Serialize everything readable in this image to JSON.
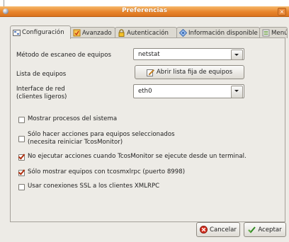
{
  "window": {
    "title": "Preferencias",
    "close_glyph": "×"
  },
  "tabs": [
    {
      "label": "Configuración",
      "icon": "config-icon",
      "active": true
    },
    {
      "label": "Avanzado",
      "icon": "advanced-icon"
    },
    {
      "label": "Autenticación",
      "icon": "lock-icon"
    },
    {
      "label": "Información disponible",
      "icon": "info-icon"
    },
    {
      "label": "Menús",
      "icon": "menu-icon"
    }
  ],
  "form": {
    "scan_method_label": "Método de escaneo de equipos",
    "scan_method_value": "netstat",
    "host_list_label": "Lista de equipos",
    "host_list_button": "Abrir lista fija de equipos",
    "interface_label_line1": "Interface de red",
    "interface_label_line2": "(clientes ligeros)",
    "interface_value": "eth0"
  },
  "checkboxes": [
    {
      "line1": "Mostrar procesos del sistema",
      "line2": "",
      "checked": false
    },
    {
      "line1": "Sólo hacer acciones para equipos seleccionados",
      "line2": "(necesita reiniciar TcosMonitor)",
      "checked": false
    },
    {
      "line1": "No ejecutar acciones cuando TcosMonitor se ejecute desde un terminal.",
      "line2": "",
      "checked": true
    },
    {
      "line1": "Sólo mostrar equipos con tcosmxlrpc (puerto 8998)",
      "line2": "",
      "checked": true
    },
    {
      "line1": "Usar conexiones SSL a los clientes XMLRPC",
      "line2": "",
      "checked": false
    }
  ],
  "footer": {
    "cancel_label": "Cancelar",
    "accept_label": "Aceptar"
  },
  "colors": {
    "titlebar": "#e8852c",
    "window_bg": "#edebe6",
    "check_mark": "#b03010"
  }
}
